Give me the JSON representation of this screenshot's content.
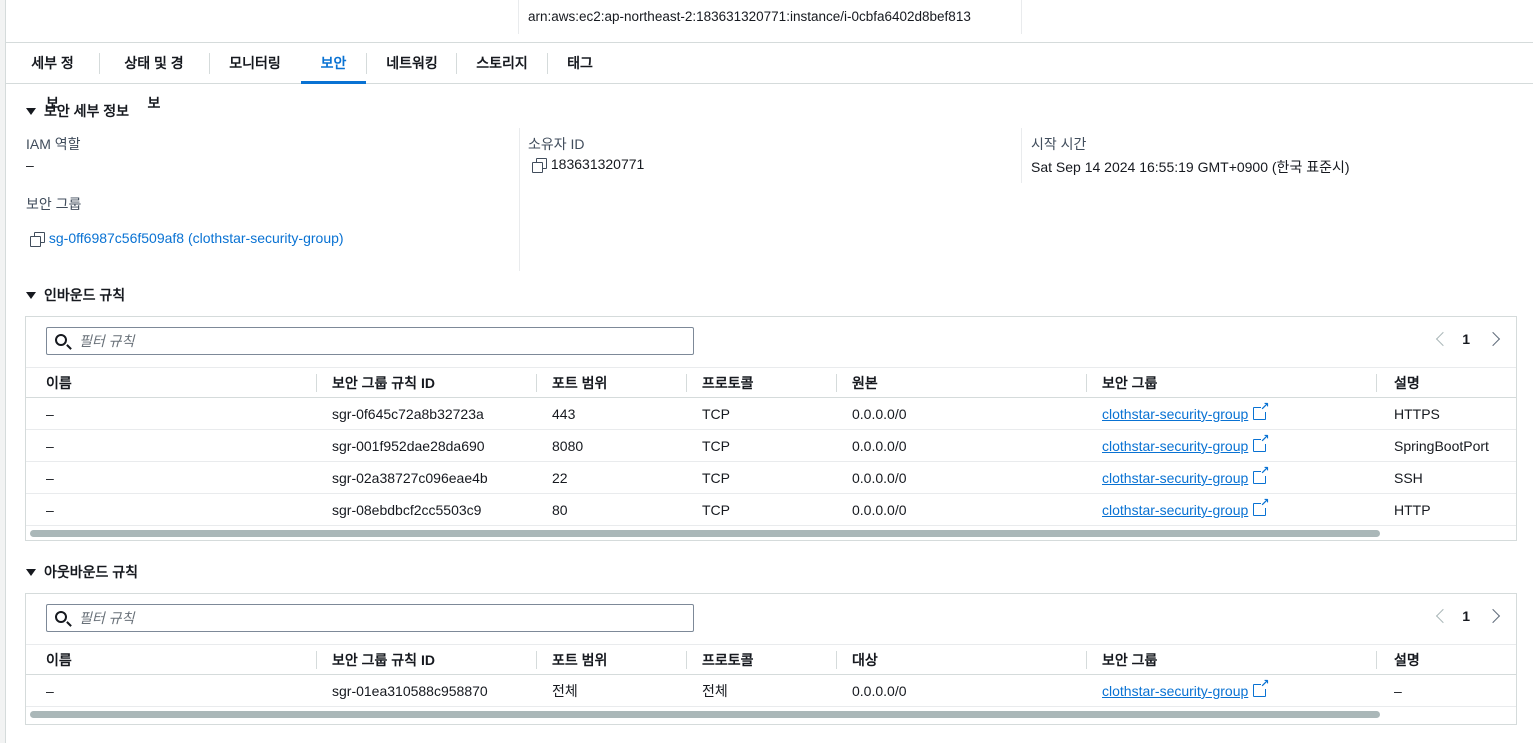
{
  "arn": "arn:aws:ec2:ap-northeast-2:183631320771:instance/i-0cbfa6402d8bef813",
  "tabs": [
    {
      "label": "세부 정보",
      "active": false
    },
    {
      "label": "상태 및 경보",
      "active": false
    },
    {
      "label": "모니터링",
      "active": false
    },
    {
      "label": "보안",
      "active": true
    },
    {
      "label": "네트워킹",
      "active": false
    },
    {
      "label": "스토리지",
      "active": false
    },
    {
      "label": "태그",
      "active": false
    }
  ],
  "security_details": {
    "heading": "보안 세부 정보",
    "iam_role_label": "IAM 역할",
    "iam_role_value": "–",
    "security_group_label": "보안 그룹",
    "security_group_link": "sg-0ff6987c56f509af8 (clothstar-security-group)",
    "owner_id_label": "소유자 ID",
    "owner_id_value": "183631320771",
    "launch_time_label": "시작 시간",
    "launch_time_value": "Sat Sep 14 2024 16:55:19 GMT+0900 (한국 표준시)"
  },
  "inbound": {
    "heading": "인바운드 규칙",
    "filter_placeholder": "필터 규칙",
    "page": "1",
    "columns": [
      "이름",
      "보안 그룹 규칙 ID",
      "포트 범위",
      "프로토콜",
      "원본",
      "보안 그룹",
      "설명"
    ],
    "rows": [
      {
        "name": "–",
        "rule_id": "sgr-0f645c72a8b32723a",
        "port": "443",
        "protocol": "TCP",
        "source": "0.0.0.0/0",
        "sg": "clothstar-security-group",
        "desc": "HTTPS"
      },
      {
        "name": "–",
        "rule_id": "sgr-001f952dae28da690",
        "port": "8080",
        "protocol": "TCP",
        "source": "0.0.0.0/0",
        "sg": "clothstar-security-group",
        "desc": "SpringBootPort"
      },
      {
        "name": "–",
        "rule_id": "sgr-02a38727c096eae4b",
        "port": "22",
        "protocol": "TCP",
        "source": "0.0.0.0/0",
        "sg": "clothstar-security-group",
        "desc": "SSH"
      },
      {
        "name": "–",
        "rule_id": "sgr-08ebdbcf2cc5503c9",
        "port": "80",
        "protocol": "TCP",
        "source": "0.0.0.0/0",
        "sg": "clothstar-security-group",
        "desc": "HTTP"
      }
    ]
  },
  "outbound": {
    "heading": "아웃바운드 규칙",
    "filter_placeholder": "필터 규칙",
    "page": "1",
    "columns": [
      "이름",
      "보안 그룹 규칙 ID",
      "포트 범위",
      "프로토콜",
      "대상",
      "보안 그룹",
      "설명"
    ],
    "rows": [
      {
        "name": "–",
        "rule_id": "sgr-01ea310588c958870",
        "port": "전체",
        "protocol": "전체",
        "source": "0.0.0.0/0",
        "sg": "clothstar-security-group",
        "desc": "–"
      }
    ]
  }
}
